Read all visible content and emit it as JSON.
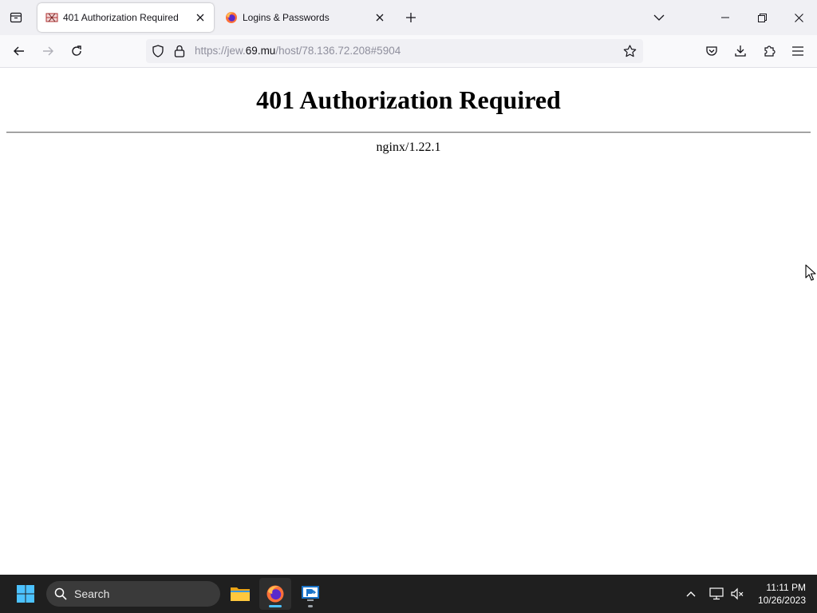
{
  "browser": {
    "tabs": [
      {
        "title": "401 Authorization Required",
        "active": true
      },
      {
        "title": "Logins & Passwords",
        "active": false
      }
    ],
    "url": {
      "prefix": "https://jew.",
      "domain": "69.mu",
      "suffix": "/host/78.136.72.208#5904"
    }
  },
  "page": {
    "heading": "401 Authorization Required",
    "server": "nginx/1.22.1"
  },
  "taskbar": {
    "search_label": "Search",
    "time": "11:11 PM",
    "date": "10/26/2023"
  },
  "colors": {
    "tabstrip": "#f0f0f4",
    "navbar": "#f9f9fb",
    "taskbar": "#1f1f1f",
    "accent": "#4cc2ff"
  }
}
